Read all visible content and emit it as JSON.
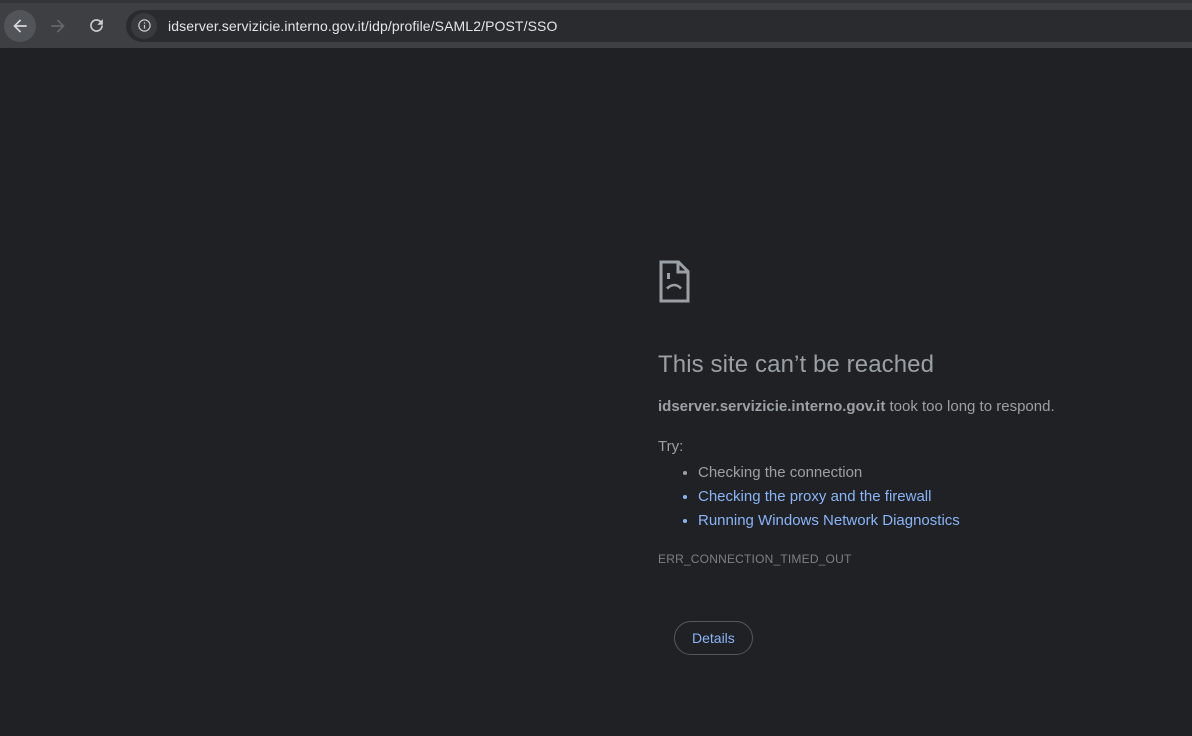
{
  "browser": {
    "url": "idserver.servizicie.interno.gov.it/idp/profile/SAML2/POST/SSO",
    "toolbar": {
      "back_icon": "back-arrow",
      "forward_icon": "forward-arrow",
      "reload_icon": "reload",
      "site_info_icon": "info-circle"
    }
  },
  "error_page": {
    "sad_file_icon": "sad-file",
    "title": "This site can’t be reached",
    "summary": {
      "domain": "idserver.servizicie.interno.gov.it",
      "rest": " took too long to respond."
    },
    "try_label": "Try:",
    "suggestions": [
      {
        "label": "Checking the connection",
        "is_link": false
      },
      {
        "label": "Checking the proxy and the firewall",
        "is_link": true
      },
      {
        "label": "Running Windows Network Diagnostics",
        "is_link": true
      }
    ],
    "error_code": "ERR_CONNECTION_TIMED_OUT",
    "details_button_label": "Details"
  },
  "colors": {
    "content_background": "#202124",
    "toolbar_background": "#3e3f42",
    "omnibox_background": "#2a2b2e",
    "text_gray": "#9aa0a6",
    "link_blue": "#8ab4f8",
    "error_code_gray": "#7a8086",
    "url_text": "#e3e5e8",
    "icon_gray": "#9aa0a6"
  }
}
